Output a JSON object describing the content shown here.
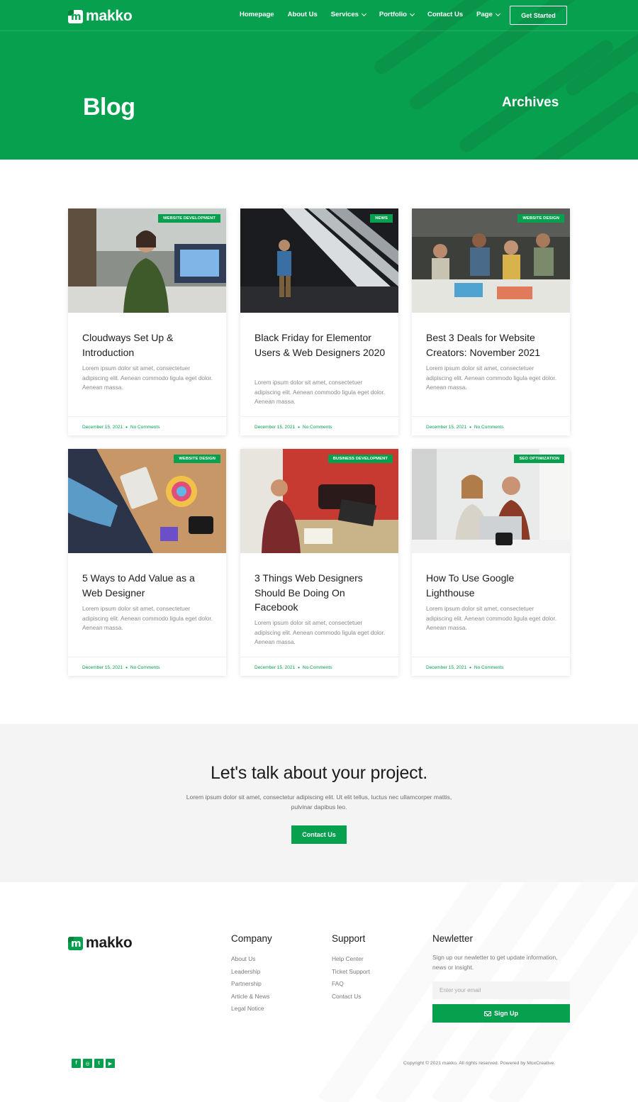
{
  "header": {
    "brand": "makko",
    "nav": [
      {
        "label": "Homepage",
        "has_dropdown": false
      },
      {
        "label": "About Us",
        "has_dropdown": false
      },
      {
        "label": "Services",
        "has_dropdown": true
      },
      {
        "label": "Portfolio",
        "has_dropdown": true
      },
      {
        "label": "Contact Us",
        "has_dropdown": false
      },
      {
        "label": "Page",
        "has_dropdown": true
      }
    ],
    "cta_label": "Get Started"
  },
  "hero": {
    "title": "Blog",
    "subtitle": "Archives"
  },
  "posts": [
    {
      "badge": "WEBSITE DEVELOPMENT",
      "title": "Cloudways Set Up & Introduction",
      "excerpt": "Lorem ipsum dolor sit amet, consectetuer adipiscing elit. Aenean commodo ligula eget dolor. Aenean massa.",
      "date": "December 15, 2021",
      "comments": "No Comments"
    },
    {
      "badge": "NEWS",
      "title": "Black Friday for Elementor Users & Web Designers 2020",
      "excerpt": "Lorem ipsum dolor sit amet, consectetuer adipiscing elit. Aenean commodo ligula eget dolor. Aenean massa.",
      "date": "December 15, 2021",
      "comments": "No Comments"
    },
    {
      "badge": "WEBSITE DESIGN",
      "title": "Best 3 Deals for Website Creators: November 2021",
      "excerpt": "Lorem ipsum dolor sit amet, consectetuer adipiscing elit. Aenean commodo ligula eget dolor. Aenean massa.",
      "date": "December 15, 2021",
      "comments": "No Comments"
    },
    {
      "badge": "WEBSITE DESIGN",
      "title": "5 Ways to Add Value as a Web Designer",
      "excerpt": "Lorem ipsum dolor sit amet, consectetuer adipiscing elit. Aenean commodo ligula eget dolor. Aenean massa.",
      "date": "December 15, 2021",
      "comments": "No Comments"
    },
    {
      "badge": "BUSINESS DEVELOPMENT",
      "title": "3 Things Web Designers Should Be Doing On Facebook",
      "excerpt": "Lorem ipsum dolor sit amet, consectetuer adipiscing elit. Aenean commodo ligula eget dolor. Aenean massa.",
      "date": "December 15, 2021",
      "comments": "No Comments"
    },
    {
      "badge": "SEO OPTIMIZATION",
      "title": "How To Use Google Lighthouse",
      "excerpt": "Lorem ipsum dolor sit amet, consectetuer adipiscing elit. Aenean commodo ligula eget dolor. Aenean massa.",
      "date": "December 15, 2021",
      "comments": "No Comments"
    }
  ],
  "cta": {
    "title": "Let's talk about your project.",
    "text": "Lorem ipsum dolor sit amet, consectetur adipiscing elit. Ut elit tellus, luctus nec ullamcorper mattis, pulvinar dapibus leo.",
    "button": "Contact Us"
  },
  "footer": {
    "brand": "makko",
    "company": {
      "title": "Company",
      "links": [
        "About Us",
        "Leadership",
        "Partnership",
        "Article & News",
        "Legal Notice"
      ]
    },
    "support": {
      "title": "Support",
      "links": [
        "Help Center",
        "Ticket Support",
        "FAQ",
        "Contact Us"
      ]
    },
    "newsletter": {
      "title": "Newletter",
      "text": "Sign up our newletter to get update information, news or insight.",
      "placeholder": "Enter your email",
      "button": "Sign Up"
    },
    "socials": [
      "facebook-icon",
      "instagram-icon",
      "twitter-icon",
      "youtube-icon"
    ],
    "copyright": "Copyright © 2021 makko. All rights reserved. Powered by MoxCreative."
  },
  "colors": {
    "brand_green": "#06a04f",
    "cta_bg": "#f4f4f4",
    "text_dark": "#1c1c1c"
  }
}
